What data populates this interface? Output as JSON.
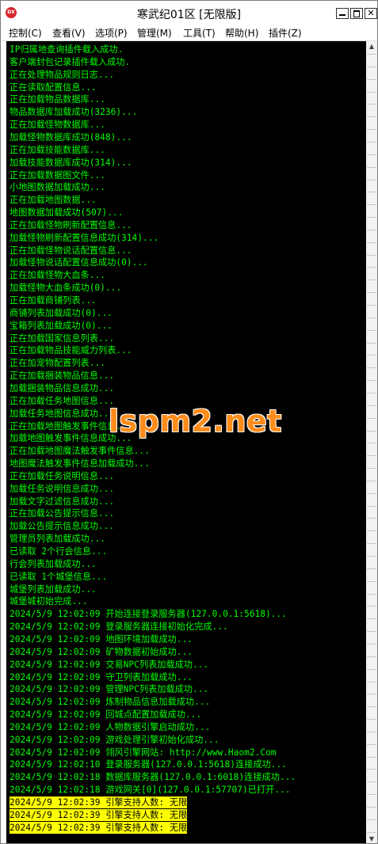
{
  "window": {
    "title": "寒武纪01区 [无限版]",
    "icon_label": "DX",
    "minimize_icon": "minimize-icon",
    "maximize_icon": "maximize-icon",
    "close_icon": "close-icon",
    "close_glyph": "✕"
  },
  "menu": [
    "控制(C)",
    "查看(V)",
    "选项(P)",
    "管理(M)",
    "工具(T)",
    "帮助(H)",
    "插件(Z)"
  ],
  "console": {
    "text_color": "#00ff00",
    "background": "#000000",
    "highlight_background": "#ffff00",
    "highlight_text_color": "#000000",
    "lines": [
      "IP归属地查询插件载入成功.",
      "客户端封包记录插件载入成功.",
      "正在处理物品规则日志...",
      "正在读取配置信息...",
      "正在加载物品数据库...",
      "物品数据库加载成功(3236)...",
      "正在加载怪物数据库...",
      "加载怪物数据库成功(848)...",
      "正在加载技能数据库...",
      "加载技能数据库成功(314)...",
      "正在加载数据图文件...",
      "小地图数据加载成功...",
      "正在加载地图数据...",
      "地图数据加载成功(507)...",
      "正在加载怪物刷新配置信息...",
      "加载怪物刷新配置信息成功(314)...",
      "正在加载怪物说话配置信息...",
      "加载怪物说话配置信息成功(0)...",
      "正在加载怪物大血条...",
      "加载怪物大血条成功(0)...",
      "正在加载商铺列表...",
      "商铺列表加载成功(0)...",
      "宝箱列表加载成功(0)...",
      "正在加载国家信息列表...",
      "正在加载物品技能威力列表...",
      "正在加宠物配置列表...",
      "正在加载捆装物品信息...",
      "加载捆装物品信息成功...",
      "正在加载任务地图信息...",
      "加载任务地图信息成功...",
      "正在加载地图触发事件信息...",
      "加载地图触发事件信息成功...",
      "正在加载地图魔法触发事件信息...",
      "地图魔法触发事件信息加载成功...",
      "正在加载任务说明信息...",
      "加载任务说明信息成功...",
      "加载文字过滤信息成功...",
      "正在加载公告提示信息...",
      "加载公告提示信息成功...",
      "管理员列表加载成功...",
      "已读取 2个行会信息...",
      "行会列表加载成功...",
      "已读取 1个城堡信息...",
      "城堡列表加载成功...",
      "城堡城初始完成...",
      "2024/5/9 12:02:09 开始连接登录服务器(127.0.0.1:5618)...",
      "2024/5/9 12:02:09 登录服务器连接初始化完成...",
      "2024/5/9 12:02:09 地图环境加载成功...",
      "2024/5/9 12:02:09 矿物数据初始成功...",
      "2024/5/9 12:02:09 交易NPC列表加载成功...",
      "2024/5/9 12:02:09 守卫列表加载成功...",
      "2024/5/9 12:02:09 管理NPC列表加载成功...",
      "2024/5/9 12:02:09 炼制物品信息加载成功...",
      "2024/5/9 12:02:09 回城点配置加载成功...",
      "2024/5/9 12:02:09 人物数据引擎启动成功...",
      "2024/5/9 12:02:09 游戏处理引擎初始化成功...",
      "2024/5/9 12:02:09 翎风引擎网站: http://www.Haom2.Com",
      "2024/5/9 12:02:10 登录服务器(127.0.0.1:5618)连接成功...",
      "2024/5/9 12:02:18 数据库服务器(127.0.0.1:6018)连接成功...",
      "2024/5/9 12:02:18 游戏网关[0](127.0.0.1:57707)已打开..."
    ],
    "highlighted_lines": [
      "2024/5/9 12:02:39 引擎支持人数: 无限",
      "2024/5/9 12:02:39 引擎支持人数: 无限",
      "2024/5/9 12:02:39 引擎支持人数: 无限"
    ]
  },
  "watermark": "lspm2.net",
  "scrollbar": {
    "up_icon": "scroll-up-arrow-icon",
    "down_icon": "scroll-down-arrow-icon",
    "up_glyph": "▲",
    "down_glyph": "▼"
  }
}
